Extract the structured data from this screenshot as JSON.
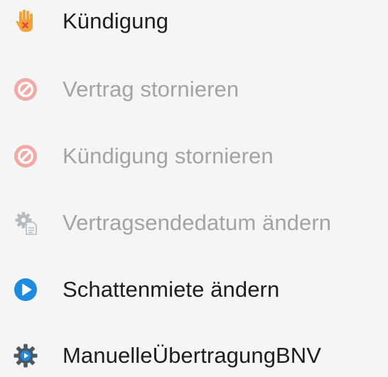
{
  "menu": {
    "items": [
      {
        "label": "Kündigung",
        "icon": "stop-hand-icon",
        "enabled": true
      },
      {
        "label": "Vertrag stornieren",
        "icon": "prohibited-icon",
        "enabled": false
      },
      {
        "label": "Kündigung stornieren",
        "icon": "prohibited-icon",
        "enabled": false
      },
      {
        "label": "Vertragsendedatum ändern",
        "icon": "gear-document-icon",
        "enabled": false
      },
      {
        "label": "Schattenmiete ändern",
        "icon": "play-circle-icon",
        "enabled": true
      },
      {
        "label": "ManuelleÜbertragungBNV",
        "icon": "gear-play-icon",
        "enabled": true
      }
    ]
  },
  "colors": {
    "background": "#f5f5f5",
    "text_enabled": "#1e1e1e",
    "text_disabled": "#a3a3a3",
    "hand": "#f3a33a",
    "hand_mark": "#e0493a",
    "prohibited_disabled": "#f4aaa4",
    "play_blue": "#1e8ae0",
    "gear": "#4a5863",
    "gear_disabled": "#b5bcc2"
  }
}
